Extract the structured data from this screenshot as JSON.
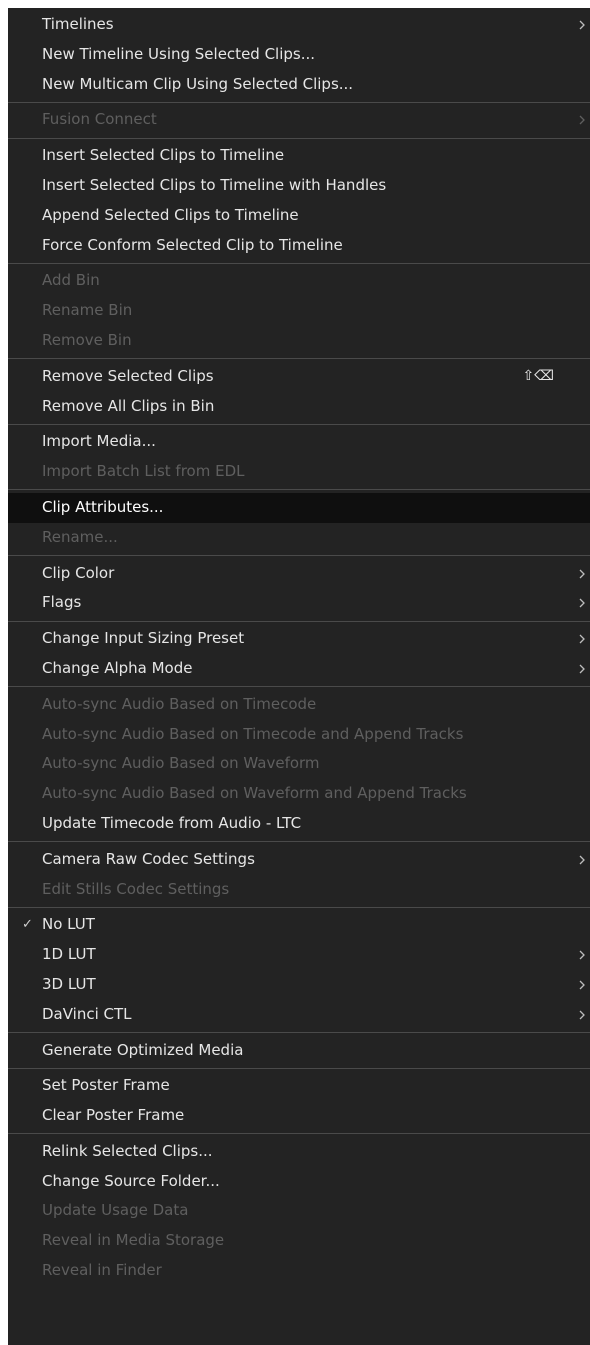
{
  "colors": {
    "menu_bg": "#232323",
    "text_enabled": "#e6e6e6",
    "text_disabled": "#5f5f5f",
    "highlight_bg": "#0f0f0f",
    "separator": "#4a4a4a"
  },
  "menu": {
    "groups": [
      {
        "items": [
          {
            "label": "Timelines",
            "disabled": false,
            "submenu": true
          },
          {
            "label": "New Timeline Using Selected Clips...",
            "disabled": false
          },
          {
            "label": "New Multicam Clip Using Selected Clips...",
            "disabled": false
          }
        ]
      },
      {
        "items": [
          {
            "label": "Fusion Connect",
            "disabled": true,
            "submenu": true
          }
        ]
      },
      {
        "items": [
          {
            "label": "Insert Selected Clips to Timeline",
            "disabled": false
          },
          {
            "label": "Insert Selected Clips to Timeline with Handles",
            "disabled": false
          },
          {
            "label": "Append Selected Clips to Timeline",
            "disabled": false
          },
          {
            "label": "Force Conform Selected Clip to Timeline",
            "disabled": false
          }
        ]
      },
      {
        "items": [
          {
            "label": "Add Bin",
            "disabled": true
          },
          {
            "label": "Rename Bin",
            "disabled": true
          },
          {
            "label": "Remove Bin",
            "disabled": true
          }
        ]
      },
      {
        "items": [
          {
            "label": "Remove Selected Clips",
            "disabled": false,
            "shortcut": "⇧⌫"
          },
          {
            "label": "Remove All Clips in Bin",
            "disabled": false
          }
        ]
      },
      {
        "items": [
          {
            "label": "Import Media...",
            "disabled": false
          },
          {
            "label": "Import Batch List from EDL",
            "disabled": true
          }
        ]
      },
      {
        "items": [
          {
            "label": "Clip Attributes...",
            "disabled": false,
            "highlighted": true
          },
          {
            "label": "Rename...",
            "disabled": true
          }
        ]
      },
      {
        "items": [
          {
            "label": "Clip Color",
            "disabled": false,
            "submenu": true
          },
          {
            "label": "Flags",
            "disabled": false,
            "submenu": true
          }
        ]
      },
      {
        "items": [
          {
            "label": "Change Input Sizing Preset",
            "disabled": false,
            "submenu": true
          },
          {
            "label": "Change Alpha Mode",
            "disabled": false,
            "submenu": true
          }
        ]
      },
      {
        "items": [
          {
            "label": "Auto-sync Audio Based on Timecode",
            "disabled": true
          },
          {
            "label": "Auto-sync Audio Based on Timecode and Append Tracks",
            "disabled": true
          },
          {
            "label": "Auto-sync Audio Based on Waveform",
            "disabled": true
          },
          {
            "label": "Auto-sync Audio Based on Waveform and Append Tracks",
            "disabled": true
          },
          {
            "label": "Update Timecode from Audio - LTC",
            "disabled": false
          }
        ]
      },
      {
        "items": [
          {
            "label": "Camera Raw Codec Settings",
            "disabled": false,
            "submenu": true
          },
          {
            "label": "Edit Stills Codec Settings",
            "disabled": true
          }
        ]
      },
      {
        "items": [
          {
            "label": "No LUT",
            "disabled": false,
            "checked": true,
            "check_mark": "✓"
          },
          {
            "label": "1D LUT",
            "disabled": false,
            "submenu": true
          },
          {
            "label": "3D LUT",
            "disabled": false,
            "submenu": true
          },
          {
            "label": "DaVinci CTL",
            "disabled": false,
            "submenu": true
          }
        ]
      },
      {
        "items": [
          {
            "label": "Generate Optimized Media",
            "disabled": false
          }
        ]
      },
      {
        "items": [
          {
            "label": "Set Poster Frame",
            "disabled": false
          },
          {
            "label": "Clear Poster Frame",
            "disabled": false
          }
        ]
      },
      {
        "items": [
          {
            "label": "Relink Selected Clips...",
            "disabled": false
          },
          {
            "label": "Change Source Folder...",
            "disabled": false
          },
          {
            "label": "Update Usage Data",
            "disabled": true
          },
          {
            "label": "Reveal in Media Storage",
            "disabled": true
          },
          {
            "label": "Reveal in Finder",
            "disabled": true
          }
        ]
      }
    ]
  }
}
